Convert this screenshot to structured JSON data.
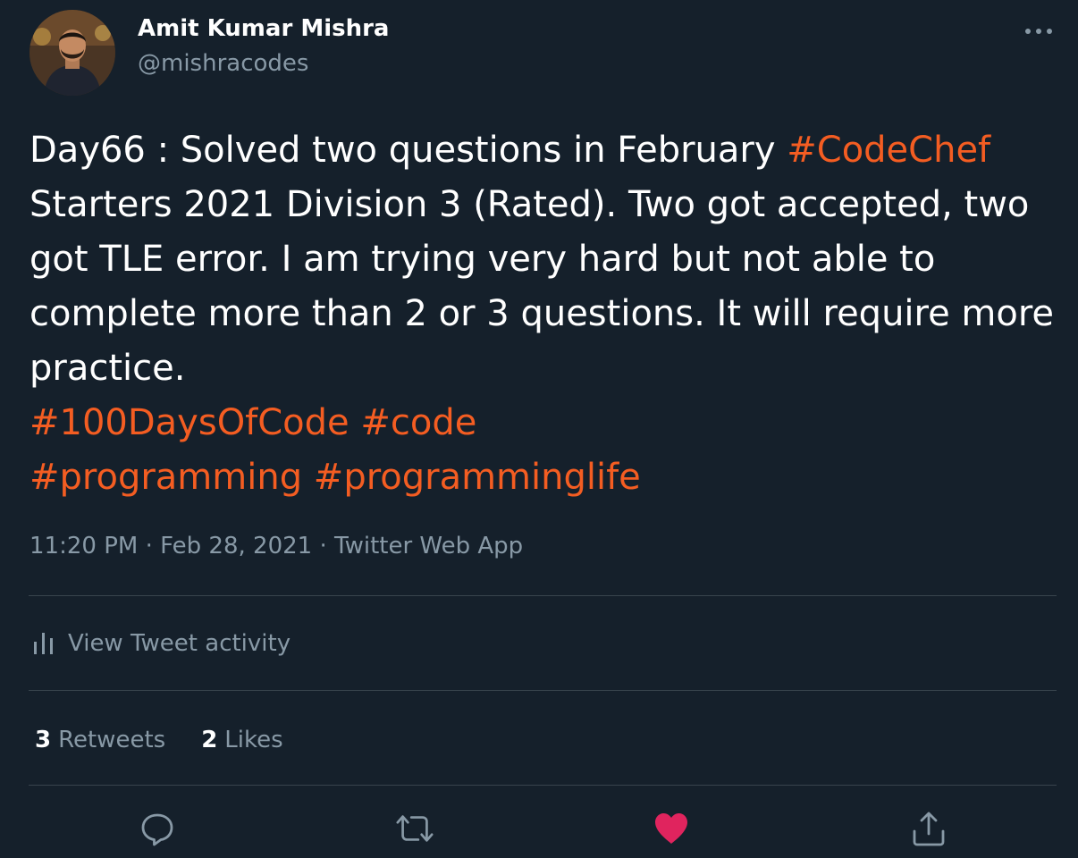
{
  "author": {
    "name": "Amit Kumar Mishra",
    "handle": "@mishracodes"
  },
  "tweet": {
    "segments": [
      {
        "text": "Day66 : Solved two questions in February ",
        "hashtag": false
      },
      {
        "text": "#CodeChef",
        "hashtag": true
      },
      {
        "text": " Starters 2021 Division 3 (Rated). Two got accepted, two got TLE error. I am trying very hard but not able to complete more than 2 or 3 questions. It will require more practice.",
        "hashtag": false
      },
      {
        "text": "\n",
        "hashtag": false
      },
      {
        "text": "#100DaysOfCode",
        "hashtag": true
      },
      {
        "text": " ",
        "hashtag": false
      },
      {
        "text": "#code",
        "hashtag": true
      },
      {
        "text": "\n",
        "hashtag": false
      },
      {
        "text": "#programming",
        "hashtag": true
      },
      {
        "text": " ",
        "hashtag": false
      },
      {
        "text": "#programminglife",
        "hashtag": true
      }
    ]
  },
  "meta": {
    "time": "11:20 PM",
    "separator": " · ",
    "date": "Feb 28, 2021",
    "source": "Twitter Web App"
  },
  "activity": {
    "label": "View Tweet activity",
    "icon": "bar-chart-icon"
  },
  "stats": {
    "retweets_count": "3",
    "retweets_label": "Retweets",
    "likes_count": "2",
    "likes_label": "Likes"
  },
  "actions": {
    "reply_icon": "reply-icon",
    "retweet_icon": "retweet-icon",
    "like_icon": "heart-icon",
    "share_icon": "share-icon",
    "liked": true
  },
  "colors": {
    "background": "#15202b",
    "text": "#ffffff",
    "secondary": "#8899a6",
    "hashtag": "#f45d22",
    "divider": "#38444d",
    "like_active": "#e0245e"
  }
}
